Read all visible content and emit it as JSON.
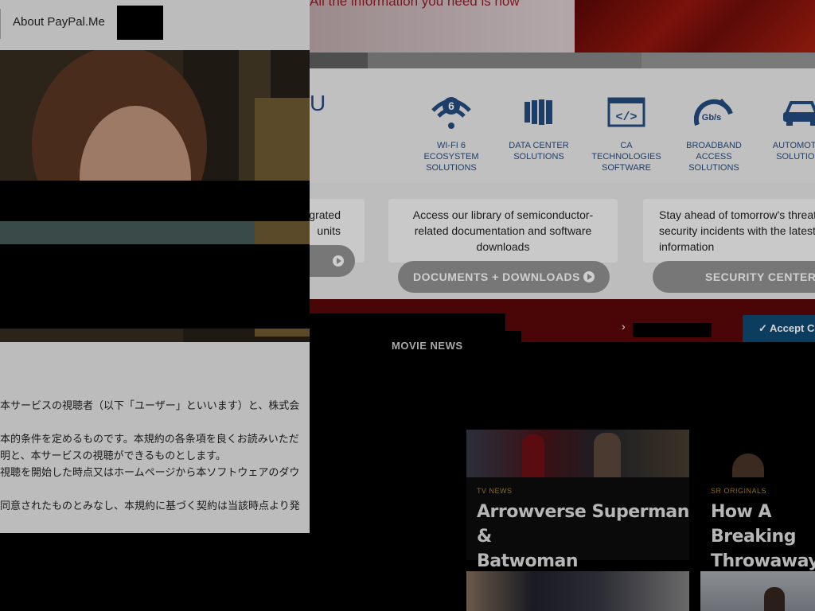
{
  "hero": {
    "text": "All the information you need is now"
  },
  "solutions": {
    "partial_letter": "U",
    "items": [
      {
        "icon": "wifi-6-icon",
        "label": "WI-FI 6\nECOSYSTEM\nSOLUTIONS"
      },
      {
        "icon": "data-center-icon",
        "label": "DATA CENTER\nSOLUTIONS"
      },
      {
        "icon": "code-window-icon",
        "label": "CA\nTECHNOLOGIES\nSOFTWARE"
      },
      {
        "icon": "speedometer-icon",
        "label": "BROADBAND\nACCESS\nSOLUTIONS"
      },
      {
        "icon": "car-icon",
        "label": "AUTOMOTIVE\nSOLUTIONS"
      }
    ]
  },
  "cards": {
    "left_partial": "grated\nunits",
    "documents": {
      "text": "Access our library of semiconductor-related documentation and software downloads",
      "button": "DOCUMENTS + DOWNLOADS"
    },
    "security": {
      "text": "Stay ahead of tomorrow's threats\nsecurity incidents with the latest\ninformation",
      "button": "SECURITY CENTER"
    }
  },
  "cookie": {
    "chevron": "›",
    "accept": "✓ Accept Cookies"
  },
  "movie_news": {
    "title": "MOVIE NEWS",
    "articles": [
      {
        "tag": "TV NEWS",
        "headline": "Arrowverse Superman &\nBatwoman Crossover..."
      },
      {
        "tag": "SR ORIGINALS",
        "headline": "How A Breaking\nThrowaway Line"
      }
    ]
  },
  "left_panel": {
    "link": "About PayPal.Me",
    "terms": [
      "本サービスの視聴者（以下「ユーザー」といいます）と、株式会",
      "本的条件を定めるものです。本規約の各条項を良くお読みいただ",
      "明と、本サービスの視聴ができるものとします。",
      "視聴を開始した時点又はホームページから本ソフトウェアのダウ",
      "同意されたものとみなし、本規約に基づく契約は当該時点より発"
    ]
  },
  "colors": {
    "accent_red": "#7a1620",
    "navy": "#1e3e6a",
    "accept_blue": "#0c3c5e"
  }
}
